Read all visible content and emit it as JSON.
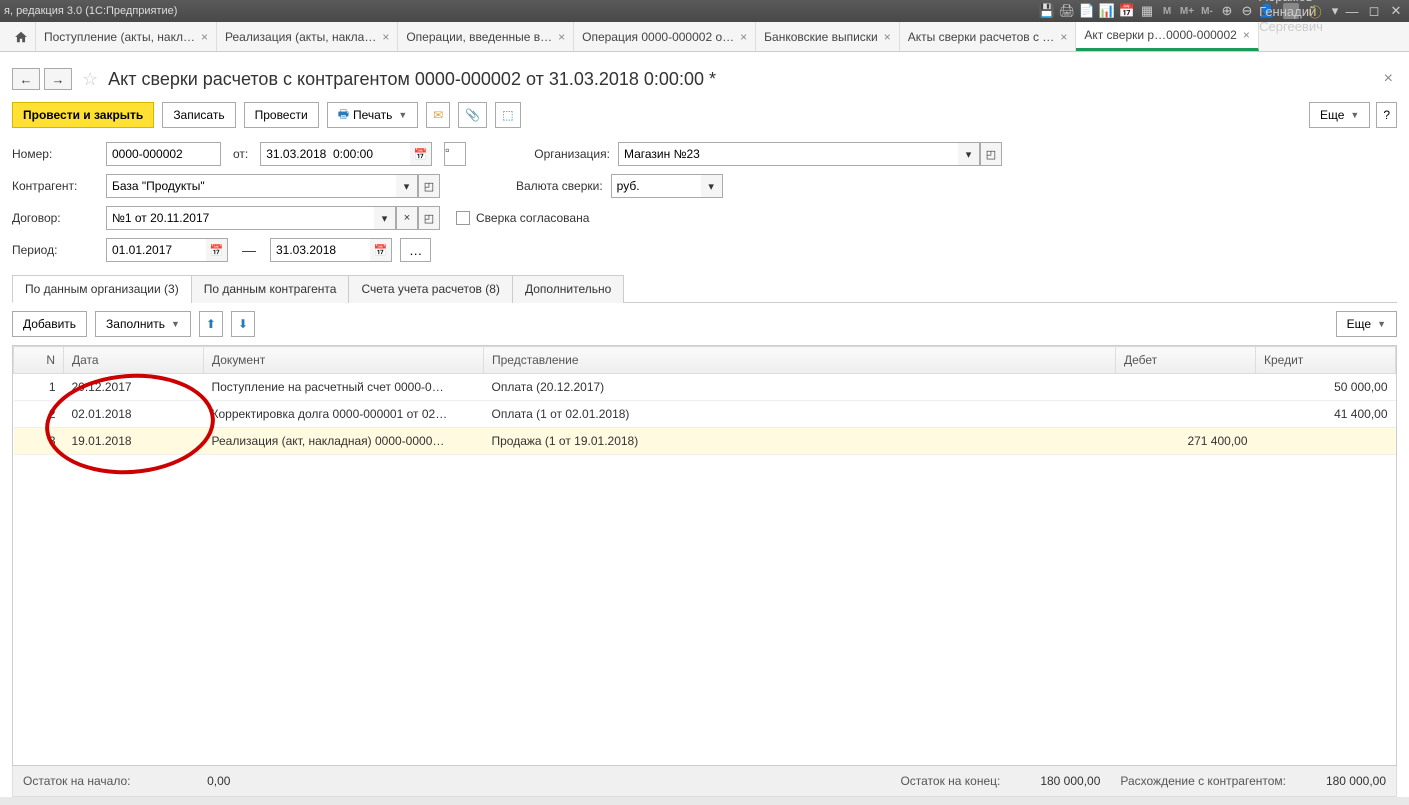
{
  "titlebar": {
    "text": "я, редакция 3.0  (1С:Предприятие)",
    "user": "Абрамов Геннадий Сергеевич"
  },
  "tabs": [
    {
      "label": "Поступление (акты, накл…"
    },
    {
      "label": "Реализация (акты, накла…"
    },
    {
      "label": "Операции, введенные в…"
    },
    {
      "label": "Операция 0000-000002 о…"
    },
    {
      "label": "Банковские выписки"
    },
    {
      "label": "Акты сверки расчетов с …"
    },
    {
      "label": "Акт сверки р…0000-000002",
      "active": true
    }
  ],
  "page_title": "Акт сверки расчетов с контрагентом 0000-000002 от 31.03.2018 0:00:00 *",
  "toolbar": {
    "post_close": "Провести и закрыть",
    "write": "Записать",
    "post": "Провести",
    "print": "Печать",
    "more": "Еще"
  },
  "form": {
    "number_label": "Номер:",
    "number_value": "0000-000002",
    "date_label": "от:",
    "date_value": "31.03.2018  0:00:00",
    "org_label": "Организация:",
    "org_value": "Магазин №23",
    "counterparty_label": "Контрагент:",
    "counterparty_value": "База \"Продукты\"",
    "currency_label": "Валюта сверки:",
    "currency_value": "руб.",
    "contract_label": "Договор:",
    "contract_value": "№1 от 20.11.2017",
    "agreed_label": "Сверка согласована",
    "period_label": "Период:",
    "period_from": "01.01.2017",
    "period_to": "31.03.2018"
  },
  "subtabs": [
    {
      "label": "По данным организации (3)",
      "active": true
    },
    {
      "label": "По данным контрагента"
    },
    {
      "label": "Счета учета расчетов (8)"
    },
    {
      "label": "Дополнительно"
    }
  ],
  "table_toolbar": {
    "add": "Добавить",
    "fill": "Заполнить",
    "more": "Еще"
  },
  "grid": {
    "headers": {
      "n": "N",
      "date": "Дата",
      "doc": "Документ",
      "repr": "Представление",
      "debit": "Дебет",
      "credit": "Кредит"
    },
    "rows": [
      {
        "n": "1",
        "date": "20.12.2017",
        "doc": "Поступление на расчетный счет 0000-0…",
        "repr": "Оплата (20.12.2017)",
        "debit": "",
        "credit": "50 000,00"
      },
      {
        "n": "2",
        "date": "02.01.2018",
        "doc": "Корректировка долга 0000-000001 от 02…",
        "repr": "Оплата (1 от 02.01.2018)",
        "debit": "",
        "credit": "41 400,00"
      },
      {
        "n": "3",
        "date": "19.01.2018",
        "doc": "Реализация (акт, накладная) 0000-0000…",
        "repr": "Продажа (1 от 19.01.2018)",
        "debit": "271 400,00",
        "credit": "",
        "selected": true
      }
    ]
  },
  "footer": {
    "start_label": "Остаток на начало:",
    "start_val": "0,00",
    "end_label": "Остаток на конец:",
    "end_val": "180 000,00",
    "diff_label": "Расхождение с контрагентом:",
    "diff_val": "180 000,00"
  }
}
